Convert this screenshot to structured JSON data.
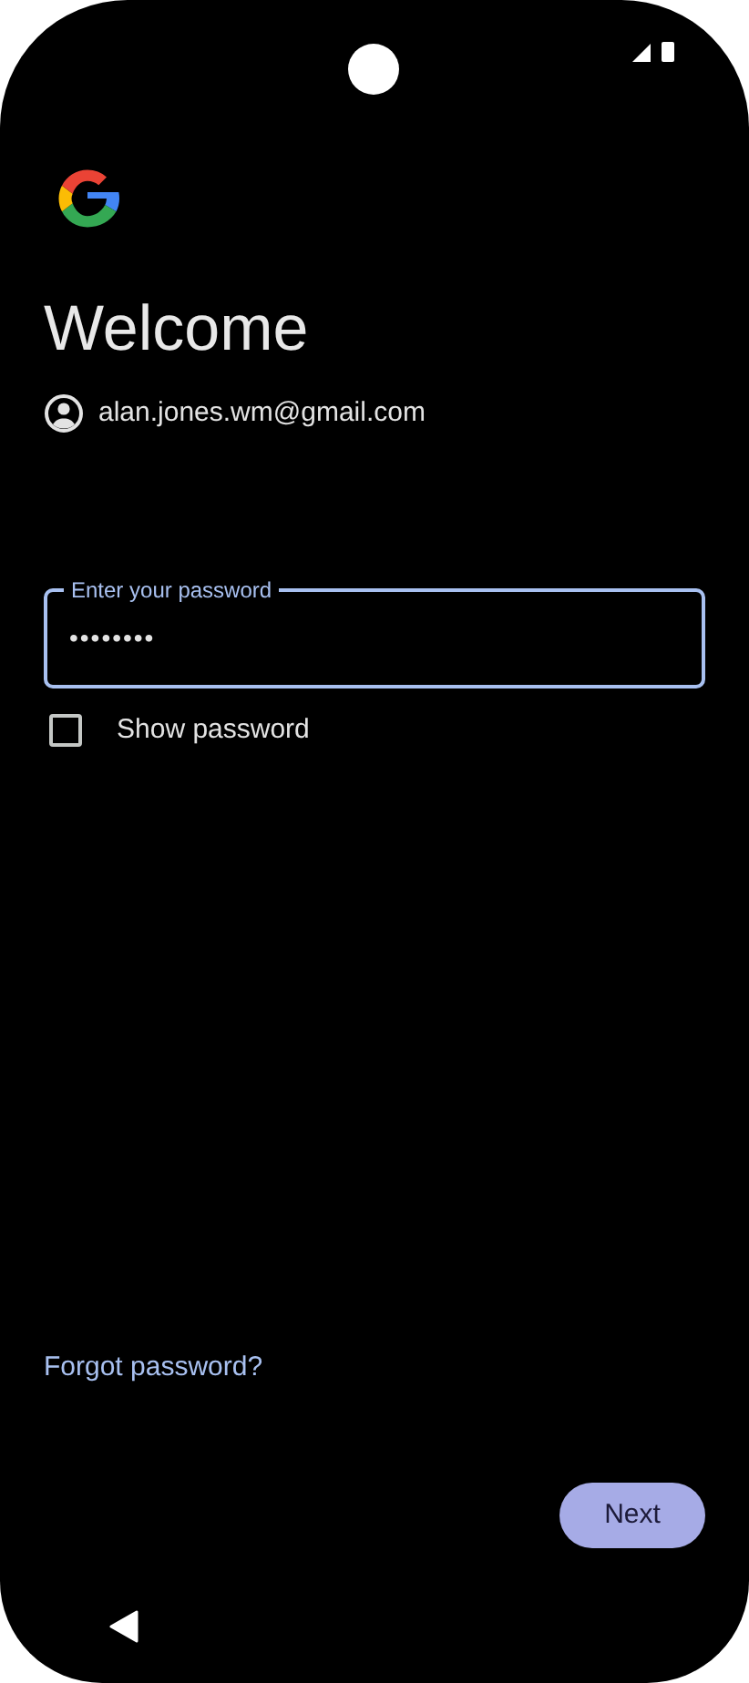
{
  "title": "Welcome",
  "account": {
    "email": "alan.jones.wm@gmail.com"
  },
  "password_field": {
    "label": "Enter your password",
    "value": "••••••••",
    "focused": true
  },
  "show_password": {
    "label": "Show password",
    "checked": false
  },
  "forgot_link": "Forgot password?",
  "next_button": "Next"
}
